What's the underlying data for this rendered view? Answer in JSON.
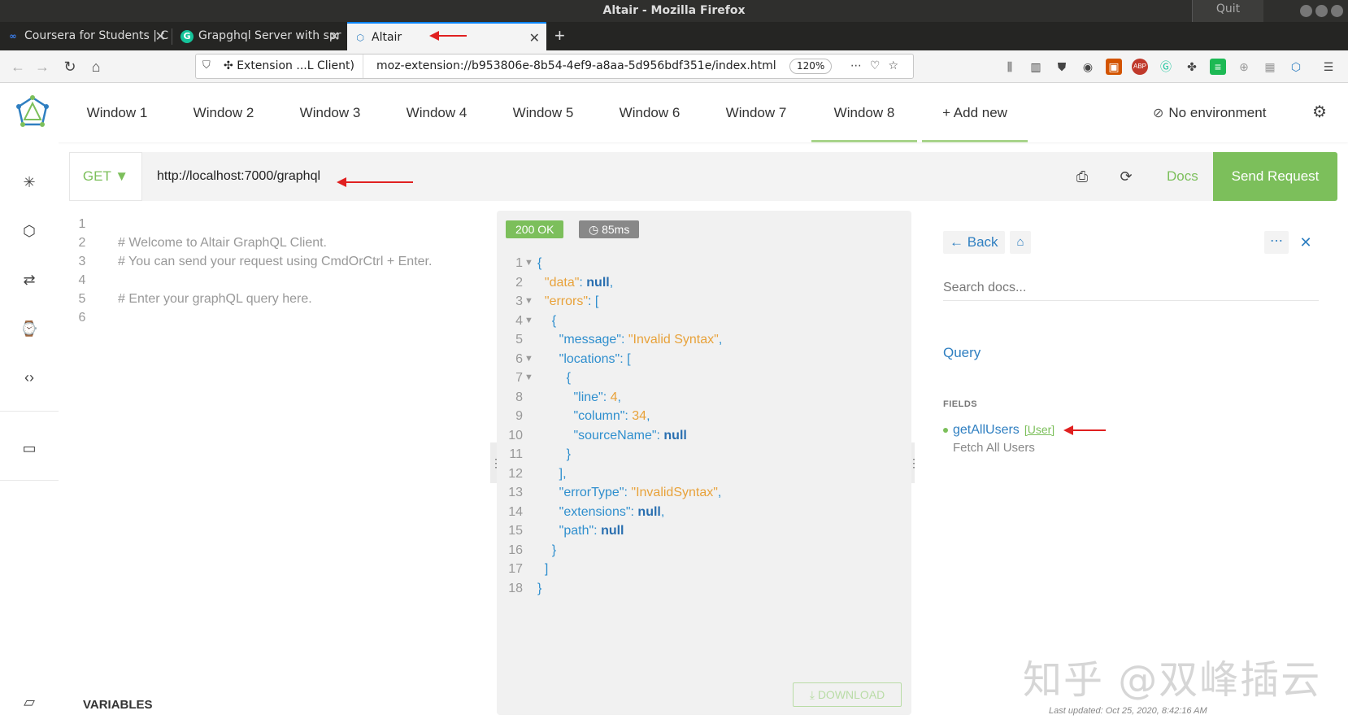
{
  "window": {
    "title": "Altair - Mozilla Firefox",
    "quit_label": "Quit"
  },
  "browser_tabs": [
    {
      "label": "Coursera for Students | C",
      "icon": "coursera-icon"
    },
    {
      "label": "Grapghql Server with spr",
      "icon": "grammarly-icon"
    },
    {
      "label": "Altair",
      "icon": "altair-icon",
      "active": true
    }
  ],
  "navbar": {
    "extension_label": "Extension ...L Client)",
    "url": "moz-extension://b953806e-8b54-4ef9-a8aa-5d956bdf351e/index.html",
    "zoom": "120%"
  },
  "altair": {
    "window_tabs": [
      "Window 1",
      "Window 2",
      "Window 3",
      "Window 4",
      "Window 5",
      "Window 6",
      "Window 7",
      "Window 8"
    ],
    "active_window": "Window 8",
    "add_new": "+ Add new",
    "environment": "No environment"
  },
  "request": {
    "method": "GET ▼",
    "url": "http://localhost:7000/graphql",
    "docs_label": "Docs",
    "send_label": "Send Request"
  },
  "query_editor": {
    "lines": [
      {
        "n": "1",
        "text": ""
      },
      {
        "n": "2",
        "text": "# Welcome to Altair GraphQL Client."
      },
      {
        "n": "3",
        "text": "# You can send your request using CmdOrCtrl + Enter."
      },
      {
        "n": "4",
        "text": ""
      },
      {
        "n": "5",
        "text": "# Enter your graphQL query here."
      },
      {
        "n": "6",
        "text": ""
      }
    ],
    "variables_label": "VARIABLES"
  },
  "result": {
    "status": "200 OK",
    "time": "85ms",
    "download_label": "DOWNLOAD"
  },
  "docs": {
    "back_label": "Back",
    "search_placeholder": "Search docs...",
    "query_label": "Query",
    "fields_header": "FIELDS",
    "field_name": "getAllUsers",
    "field_type": "[User]",
    "field_description": "Fetch All Users",
    "last_updated": "Last updated: Oct 25, 2020, 8:42:16 AM"
  },
  "watermark": "知乎 @双峰插云",
  "colors": {
    "accent_green": "#7cbf5b",
    "link_blue": "#2f7fc1",
    "annotation_red": "#e02020"
  }
}
